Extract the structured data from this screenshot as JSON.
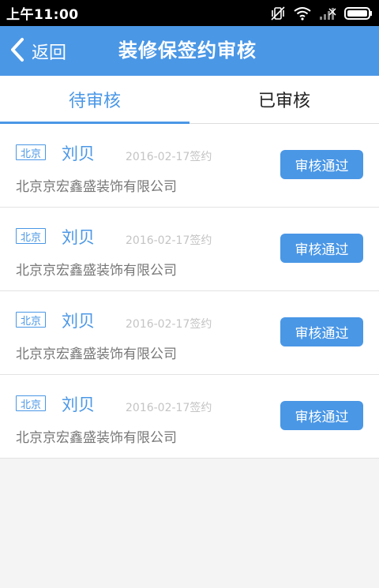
{
  "status_bar": {
    "time": "上午11:00",
    "icons": [
      "vibrate-icon",
      "wifi-icon",
      "signal-icon",
      "battery-icon"
    ]
  },
  "nav": {
    "back_label": "返回",
    "title": "装修保签约审核"
  },
  "tabs": [
    {
      "label": "待审核",
      "active": true
    },
    {
      "label": "已审核",
      "active": false
    }
  ],
  "records": [
    {
      "city": "北京",
      "name": "刘贝",
      "date": "2016-02-17签约",
      "company": "北京京宏鑫盛装饰有限公司",
      "action": "审核通过"
    },
    {
      "city": "北京",
      "name": "刘贝",
      "date": "2016-02-17签约",
      "company": "北京京宏鑫盛装饰有限公司",
      "action": "审核通过"
    },
    {
      "city": "北京",
      "name": "刘贝",
      "date": "2016-02-17签约",
      "company": "北京京宏鑫盛装饰有限公司",
      "action": "审核通过"
    },
    {
      "city": "北京",
      "name": "刘贝",
      "date": "2016-02-17签约",
      "company": "北京京宏鑫盛装饰有限公司",
      "action": "审核通过"
    }
  ],
  "colors": {
    "accent": "#4a97e6",
    "status_bar": "#000000",
    "muted_text": "#777777",
    "date_text": "#c4c4c4"
  }
}
